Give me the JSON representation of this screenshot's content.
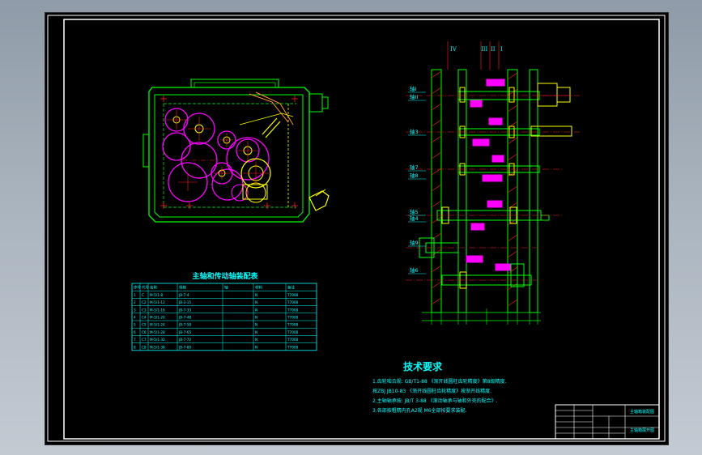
{
  "titles": {
    "table_title": "主轴和传动轴装配表",
    "tech_title": "技术要求"
  },
  "tech_requirements": [
    "1.齿轮啮合规:  GB/T1-88 《渐开线圆柱齿轮精度》第8级精度.",
    "   按ZBJ  JB10-83 《渐开线圆柱齿轮精度》按渐开线精度.",
    "2.主轴轴承按:  JB/T 3-88 《滚动轴承与轴和外壳的配合》.",
    "3.各部按粗精内孔A2规  M6全部按要求装配."
  ],
  "shaft_labels": [
    "轴I",
    "轴II",
    "轴3",
    "轴7",
    "轴8",
    "轴5",
    "轴4",
    "轴9",
    "轴6"
  ],
  "roman_marks": [
    "IV",
    "III",
    "II",
    "I"
  ],
  "table": {
    "headers": [
      "序号",
      "代号",
      "名称",
      "规格",
      "轴",
      "材料",
      "备注"
    ],
    "rows": [
      [
        "1",
        "C",
        "M-5/1-8",
        "JB-7-4",
        "",
        "N",
        "T7008"
      ],
      [
        "2",
        "C2",
        "M-5/1-12",
        "JB-2-15",
        "",
        "N",
        "T7008"
      ],
      [
        "3",
        "C3",
        "M-5/1-16",
        "JB-7-33",
        "",
        "N",
        "T7008"
      ],
      [
        "4",
        "C4",
        "M-5/1-20",
        "JB-7-48",
        "",
        "N",
        "T7008"
      ],
      [
        "5",
        "C5",
        "M-5/1-24",
        "JB-7-58",
        "",
        "N",
        "T7008"
      ],
      [
        "6",
        "C6",
        "M-5/1-28",
        "JB-7-65",
        "",
        "N",
        "T7008"
      ],
      [
        "7",
        "C7",
        "M-5/1-32",
        "JB-7-72",
        "",
        "N",
        "T7008"
      ],
      [
        "8",
        "C8",
        "M-5/1-36",
        "JB-7-80",
        "",
        "N",
        "T7008"
      ]
    ]
  },
  "title_block": {
    "drawing_name": "主轴箱装配图",
    "sub_name": "主轴箱展开图"
  },
  "colors": {
    "green": "#00ff00",
    "cyan": "#00ffff",
    "magenta": "#ff00ff",
    "yellow": "#ffff00",
    "red": "#ff2020",
    "white": "#ffffff",
    "orange": "#ff9a30"
  }
}
